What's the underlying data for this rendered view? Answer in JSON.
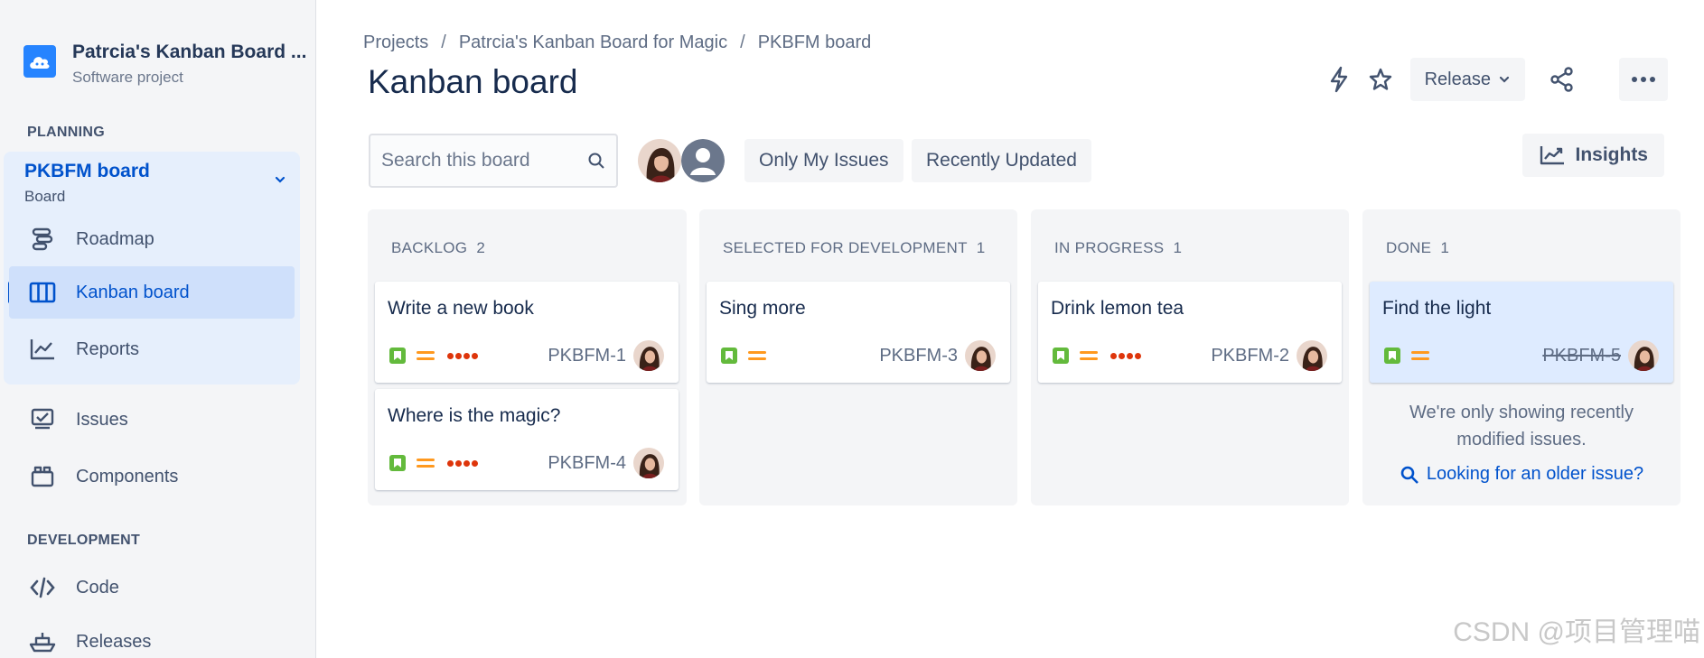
{
  "project": {
    "name": "Patrcia's Kanban Board ...",
    "type": "Software project"
  },
  "sidebar": {
    "planning_label": "PLANNING",
    "board_select": {
      "title": "PKBFM board",
      "subtitle": "Board"
    },
    "planning_items": [
      {
        "label": "Roadmap",
        "icon": "roadmap-icon"
      },
      {
        "label": "Kanban board",
        "icon": "board-icon",
        "active": true
      },
      {
        "label": "Reports",
        "icon": "reports-icon"
      }
    ],
    "other_items": [
      {
        "label": "Issues",
        "icon": "issues-icon"
      },
      {
        "label": "Components",
        "icon": "components-icon"
      }
    ],
    "development_label": "DEVELOPMENT",
    "development_items": [
      {
        "label": "Code",
        "icon": "code-icon"
      },
      {
        "label": "Releases",
        "icon": "releases-icon"
      }
    ]
  },
  "breadcrumb": {
    "items": [
      "Projects",
      "Patrcia's Kanban Board for Magic",
      "PKBFM board"
    ],
    "separator": "/"
  },
  "page_title": "Kanban board",
  "top_actions": {
    "release_label": "Release"
  },
  "toolbar": {
    "search_placeholder": "Search this board",
    "filters": [
      "Only My Issues",
      "Recently Updated"
    ],
    "insights_label": "Insights"
  },
  "columns": [
    {
      "name": "BACKLOG",
      "count": "2",
      "cards": [
        {
          "title": "Write a new book",
          "key": "PKBFM-1",
          "priority_dots": true
        },
        {
          "title": "Where is the magic?",
          "key": "PKBFM-4",
          "priority_dots": true
        }
      ]
    },
    {
      "name": "SELECTED FOR DEVELOPMENT",
      "count": "1",
      "cards": [
        {
          "title": "Sing more",
          "key": "PKBFM-3",
          "priority_dots": false
        }
      ]
    },
    {
      "name": "IN PROGRESS",
      "count": "1",
      "cards": [
        {
          "title": "Drink lemon tea",
          "key": "PKBFM-2",
          "priority_dots": true
        }
      ]
    },
    {
      "name": "DONE",
      "count": "1",
      "cards": [
        {
          "title": "Find the light",
          "key": "PKBFM-5",
          "priority_dots": false
        }
      ],
      "note_line1": "We're only showing recently",
      "note_line2": "modified issues.",
      "older_link": "Looking for an older issue?"
    }
  ],
  "watermark": "CSDN @项目管理喵",
  "colors": {
    "accent": "#0052cc",
    "story": "#63ba3c",
    "priority_medium": "#ff991f",
    "dots": "#de350b"
  }
}
